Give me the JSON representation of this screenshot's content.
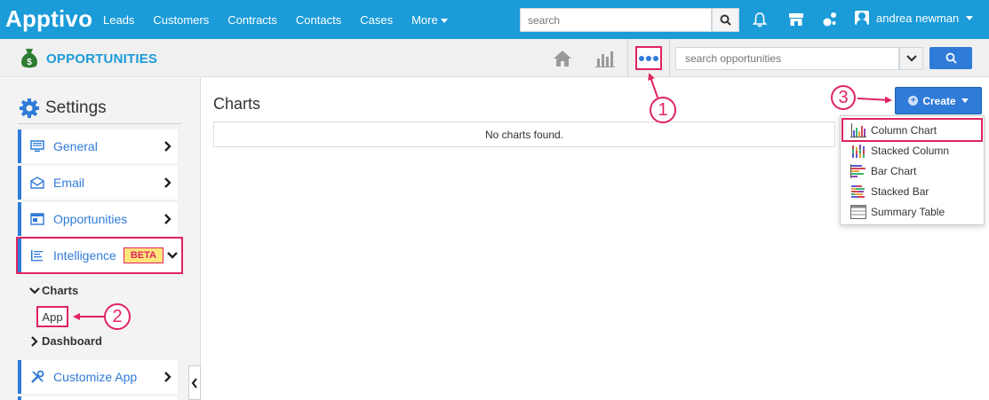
{
  "app": {
    "logo": "Apptivo"
  },
  "topnav": {
    "items": [
      "Leads",
      "Customers",
      "Contracts",
      "Contacts",
      "Cases"
    ],
    "more_label": "More"
  },
  "global_search": {
    "placeholder": "search"
  },
  "user": {
    "name": "andrea newman"
  },
  "module": {
    "title": "OPPORTUNITIES",
    "search_placeholder": "search opportunities"
  },
  "sidebar": {
    "title": "Settings",
    "items": [
      {
        "label": "General",
        "icon": "monitor-icon"
      },
      {
        "label": "Email",
        "icon": "envelope-icon"
      },
      {
        "label": "Opportunities",
        "icon": "window-icon"
      },
      {
        "label": "Intelligence",
        "icon": "list-icon",
        "badge": "BETA"
      }
    ],
    "tree": {
      "charts_label": "Charts",
      "app_label": "App",
      "dashboard_label": "Dashboard"
    },
    "customize_label": "Customize App"
  },
  "main": {
    "title": "Charts",
    "empty_text": "No charts found.",
    "create_label": "Create"
  },
  "create_menu": {
    "items": [
      {
        "label": "Column Chart",
        "icon": "column-chart-icon"
      },
      {
        "label": "Stacked Column",
        "icon": "stacked-column-icon"
      },
      {
        "label": "Bar Chart",
        "icon": "bar-chart-icon"
      },
      {
        "label": "Stacked Bar",
        "icon": "stacked-bar-icon"
      },
      {
        "label": "Summary Table",
        "icon": "table-icon"
      }
    ]
  },
  "annotations": [
    "1",
    "2",
    "3"
  ],
  "colors": {
    "brand": "#1b9bd8",
    "accent": "#2f7bd8",
    "highlight": "#e0245e",
    "beta_bg": "#ffe57a"
  }
}
